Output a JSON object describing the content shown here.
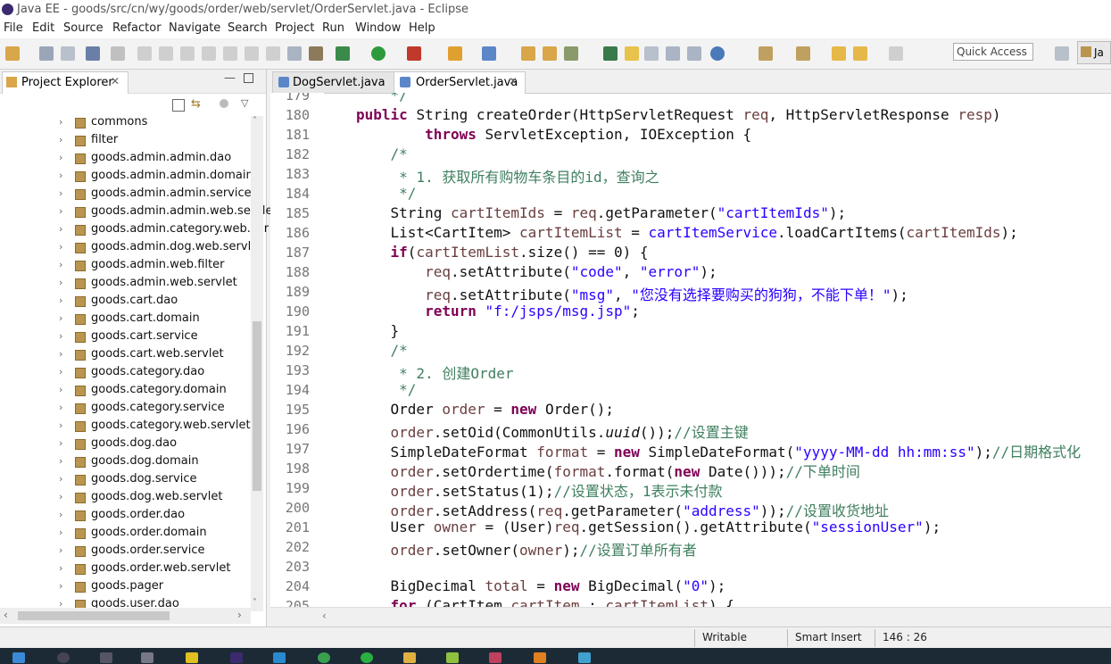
{
  "window": {
    "title": "Java EE - goods/src/cn/wy/goods/order/web/servlet/OrderServlet.java - Eclipse"
  },
  "menu": [
    "File",
    "Edit",
    "Source",
    "Refactor",
    "Navigate",
    "Search",
    "Project",
    "Run",
    "Window",
    "Help"
  ],
  "toolbar": {
    "quick_access": "Quick Access",
    "perspective": "Ja"
  },
  "project_explorer": {
    "title": "Project Explorer",
    "items": [
      "commons",
      "filter",
      "goods.admin.admin.dao",
      "goods.admin.admin.domain",
      "goods.admin.admin.service",
      "goods.admin.admin.web.servle",
      "goods.admin.category.web.ser",
      "goods.admin.dog.web.servlet",
      "goods.admin.web.filter",
      "goods.admin.web.servlet",
      "goods.cart.dao",
      "goods.cart.domain",
      "goods.cart.service",
      "goods.cart.web.servlet",
      "goods.category.dao",
      "goods.category.domain",
      "goods.category.service",
      "goods.category.web.servlet",
      "goods.dog.dao",
      "goods.dog.domain",
      "goods.dog.service",
      "goods.dog.web.servlet",
      "goods.order.dao",
      "goods.order.domain",
      "goods.order.service",
      "goods.order.web.servlet",
      "goods.pager",
      "goods.user.dao"
    ]
  },
  "editor": {
    "tabs": [
      {
        "label": "DogServlet.java"
      },
      {
        "label": "OrderServlet.java"
      }
    ],
    "line_numbers": [
      "179",
      "180",
      "181",
      "182",
      "183",
      "184",
      "185",
      "186",
      "187",
      "188",
      "189",
      "190",
      "191",
      "192",
      "193",
      "194",
      "195",
      "196",
      "197",
      "198",
      "199",
      "200",
      "201",
      "202",
      "203",
      "204",
      "205"
    ],
    "lines": [
      [
        {
          "t": "    */",
          "c": "cmt"
        }
      ],
      [
        {
          "t": "public ",
          "c": "kw"
        },
        {
          "t": "String createOrder(HttpServletRequest "
        },
        {
          "t": "req",
          "c": "fld"
        },
        {
          "t": ", HttpServletResponse "
        },
        {
          "t": "resp",
          "c": "fld"
        },
        {
          "t": ")"
        }
      ],
      [
        {
          "t": "        "
        },
        {
          "t": "throws ",
          "c": "kw"
        },
        {
          "t": "ServletException, IOException {"
        }
      ],
      [
        {
          "t": "    /*",
          "c": "cmt"
        }
      ],
      [
        {
          "t": "     * 1. 获取所有购物车条目的id，查询之",
          "c": "cmt"
        }
      ],
      [
        {
          "t": "     */",
          "c": "cmt"
        }
      ],
      [
        {
          "t": "    String "
        },
        {
          "t": "cartItemIds",
          "c": "fld"
        },
        {
          "t": " = "
        },
        {
          "t": "req",
          "c": "fld"
        },
        {
          "t": ".getParameter("
        },
        {
          "t": "\"cartItemIds\"",
          "c": "str"
        },
        {
          "t": ");"
        }
      ],
      [
        {
          "t": "    List<CartItem> "
        },
        {
          "t": "cartItemList",
          "c": "fld"
        },
        {
          "t": " = "
        },
        {
          "t": "cartItemService",
          "c": "str"
        },
        {
          "t": ".loadCartItems("
        },
        {
          "t": "cartItemIds",
          "c": "fld"
        },
        {
          "t": ");"
        }
      ],
      [
        {
          "t": "    "
        },
        {
          "t": "if",
          "c": "kw"
        },
        {
          "t": "("
        },
        {
          "t": "cartItemList",
          "c": "fld"
        },
        {
          "t": ".size() == 0) {"
        }
      ],
      [
        {
          "t": "        "
        },
        {
          "t": "req",
          "c": "fld"
        },
        {
          "t": ".setAttribute("
        },
        {
          "t": "\"code\"",
          "c": "str"
        },
        {
          "t": ", "
        },
        {
          "t": "\"error\"",
          "c": "str"
        },
        {
          "t": ");"
        }
      ],
      [
        {
          "t": "        "
        },
        {
          "t": "req",
          "c": "fld"
        },
        {
          "t": ".setAttribute("
        },
        {
          "t": "\"msg\"",
          "c": "str"
        },
        {
          "t": ", "
        },
        {
          "t": "\"您没有选择要购买的狗狗，不能下单！\"",
          "c": "str"
        },
        {
          "t": ");"
        }
      ],
      [
        {
          "t": "        "
        },
        {
          "t": "return ",
          "c": "kw"
        },
        {
          "t": "\"f:/jsps/msg.jsp\"",
          "c": "str"
        },
        {
          "t": ";"
        }
      ],
      [
        {
          "t": "    }"
        }
      ],
      [
        {
          "t": "    /*",
          "c": "cmt"
        }
      ],
      [
        {
          "t": "     * 2. 创建Order",
          "c": "cmt"
        }
      ],
      [
        {
          "t": "     */",
          "c": "cmt"
        }
      ],
      [
        {
          "t": "    Order "
        },
        {
          "t": "order",
          "c": "fld"
        },
        {
          "t": " = "
        },
        {
          "t": "new ",
          "c": "kw"
        },
        {
          "t": "Order();"
        }
      ],
      [
        {
          "t": "    "
        },
        {
          "t": "order",
          "c": "fld"
        },
        {
          "t": ".setOid(CommonUtils."
        },
        {
          "t": "uuid",
          "c": "it"
        },
        {
          "t": "());"
        },
        {
          "t": "//设置主键",
          "c": "cmt"
        }
      ],
      [
        {
          "t": "    SimpleDateFormat "
        },
        {
          "t": "format",
          "c": "fld"
        },
        {
          "t": " = "
        },
        {
          "t": "new ",
          "c": "kw"
        },
        {
          "t": "SimpleDateFormat("
        },
        {
          "t": "\"yyyy-MM-dd hh:mm:ss\"",
          "c": "str"
        },
        {
          "t": ");"
        },
        {
          "t": "//日期格式化",
          "c": "cmt"
        }
      ],
      [
        {
          "t": "    "
        },
        {
          "t": "order",
          "c": "fld"
        },
        {
          "t": ".setOrdertime("
        },
        {
          "t": "format",
          "c": "fld"
        },
        {
          "t": ".format("
        },
        {
          "t": "new ",
          "c": "kw"
        },
        {
          "t": "Date()));"
        },
        {
          "t": "//下单时间",
          "c": "cmt"
        }
      ],
      [
        {
          "t": "    "
        },
        {
          "t": "order",
          "c": "fld"
        },
        {
          "t": ".setStatus(1);"
        },
        {
          "t": "//设置状态，1表示未付款",
          "c": "cmt"
        }
      ],
      [
        {
          "t": "    "
        },
        {
          "t": "order",
          "c": "fld"
        },
        {
          "t": ".setAddress("
        },
        {
          "t": "req",
          "c": "fld"
        },
        {
          "t": ".getParameter("
        },
        {
          "t": "\"address\"",
          "c": "str"
        },
        {
          "t": "));"
        },
        {
          "t": "//设置收货地址",
          "c": "cmt"
        }
      ],
      [
        {
          "t": "    User "
        },
        {
          "t": "owner",
          "c": "fld"
        },
        {
          "t": " = (User)"
        },
        {
          "t": "req",
          "c": "fld"
        },
        {
          "t": ".getSession().getAttribute("
        },
        {
          "t": "\"sessionUser\"",
          "c": "str"
        },
        {
          "t": ");"
        }
      ],
      [
        {
          "t": "    "
        },
        {
          "t": "order",
          "c": "fld"
        },
        {
          "t": ".setOwner("
        },
        {
          "t": "owner",
          "c": "fld"
        },
        {
          "t": ");"
        },
        {
          "t": "//设置订单所有者",
          "c": "cmt"
        }
      ],
      [
        {
          "t": ""
        }
      ],
      [
        {
          "t": "    BigDecimal "
        },
        {
          "t": "total",
          "c": "fld"
        },
        {
          "t": " = "
        },
        {
          "t": "new ",
          "c": "kw"
        },
        {
          "t": "BigDecimal("
        },
        {
          "t": "\"0\"",
          "c": "str"
        },
        {
          "t": ");"
        }
      ],
      [
        {
          "t": "    "
        },
        {
          "t": "for",
          "c": "kw"
        },
        {
          "t": " (CartItem "
        },
        {
          "t": "cartItem",
          "c": "fld"
        },
        {
          "t": " : "
        },
        {
          "t": "cartItemList",
          "c": "fld"
        },
        {
          "t": ") {"
        }
      ]
    ]
  },
  "status": {
    "mode": "Writable",
    "insert": "Smart Insert",
    "position": "146 : 26"
  },
  "colors": {
    "keyword": "#7f0055",
    "string": "#2a00ff",
    "comment": "#3f7f5f",
    "field": "#6a3e3e"
  }
}
